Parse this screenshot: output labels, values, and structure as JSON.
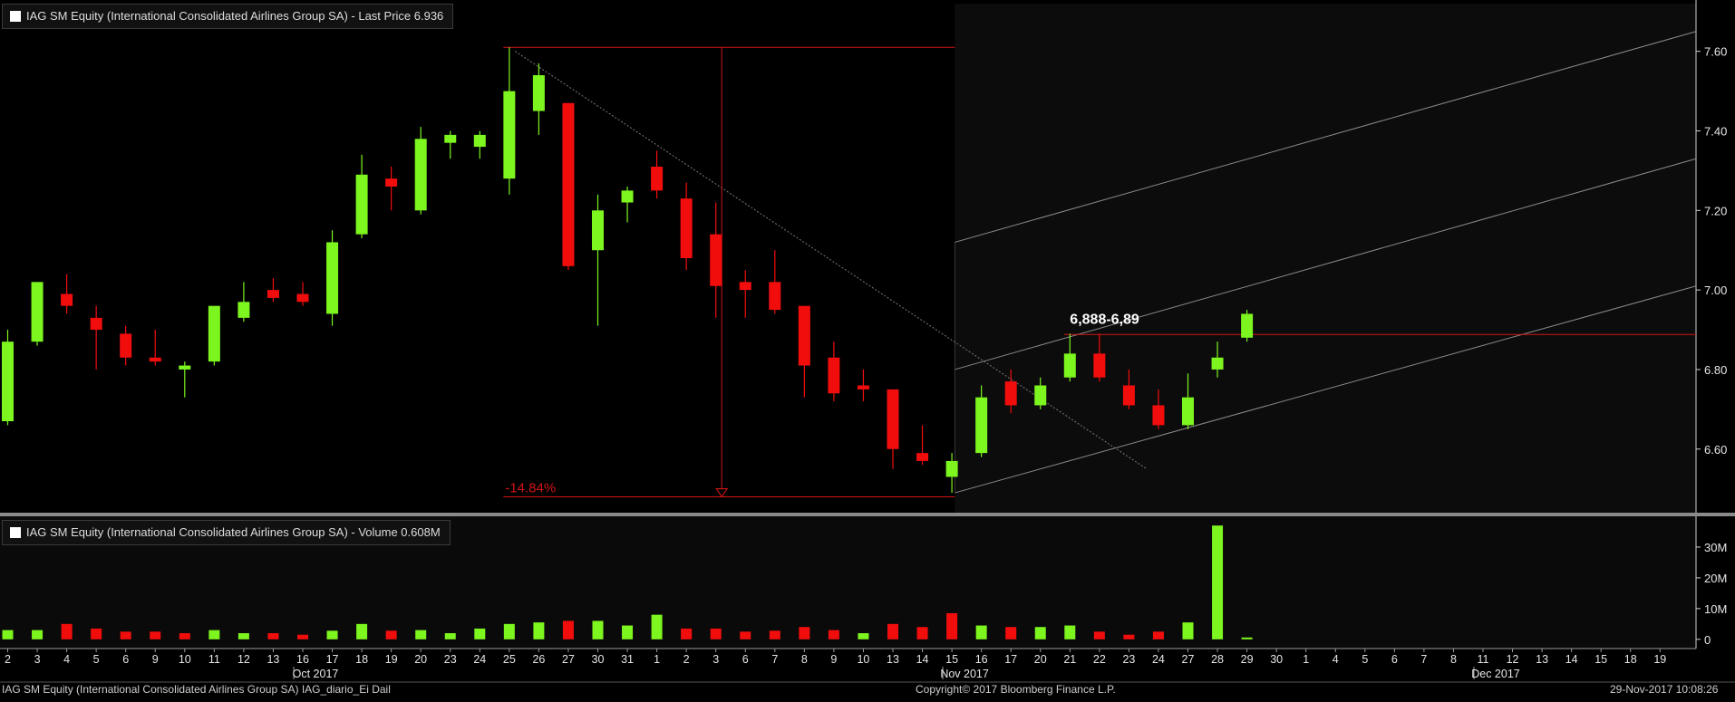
{
  "chart_data": [
    {
      "type": "candlestick",
      "title": "IAG SM Equity (International Consolidated Airlines Group SA) - Last Price 6.936",
      "y_ticks": [
        "7.60",
        "7.40",
        "7.20",
        "7.00",
        "6.80",
        "6.60"
      ],
      "ylim": [
        6.44,
        7.72
      ],
      "x_day_labels": [
        "2",
        "3",
        "4",
        "5",
        "6",
        "9",
        "10",
        "11",
        "12",
        "13",
        "16",
        "17",
        "18",
        "19",
        "20",
        "23",
        "24",
        "25",
        "26",
        "27",
        "30",
        "31",
        "1",
        "2",
        "3",
        "6",
        "7",
        "8",
        "9",
        "10",
        "13",
        "14",
        "15",
        "16",
        "17",
        "20",
        "21",
        "22",
        "23",
        "24",
        "27",
        "28",
        "29",
        "30",
        "1",
        "4",
        "5",
        "6",
        "7",
        "8",
        "11",
        "12",
        "13",
        "14",
        "15",
        "18",
        "19"
      ],
      "x_month_labels": [
        {
          "label": "Oct 2017",
          "index": 10
        },
        {
          "label": "Nov 2017",
          "index": 32
        },
        {
          "label": "Dec 2017",
          "index": 50
        }
      ],
      "candles": [
        {
          "o": 6.67,
          "h": 6.9,
          "l": 6.66,
          "c": 6.87
        },
        {
          "o": 6.87,
          "h": 7.02,
          "l": 6.86,
          "c": 7.02
        },
        {
          "o": 6.99,
          "h": 7.04,
          "l": 6.94,
          "c": 6.96
        },
        {
          "o": 6.93,
          "h": 6.96,
          "l": 6.8,
          "c": 6.9
        },
        {
          "o": 6.89,
          "h": 6.91,
          "l": 6.81,
          "c": 6.83
        },
        {
          "o": 6.83,
          "h": 6.9,
          "l": 6.81,
          "c": 6.82
        },
        {
          "o": 6.8,
          "h": 6.82,
          "l": 6.73,
          "c": 6.81
        },
        {
          "o": 6.82,
          "h": 6.96,
          "l": 6.81,
          "c": 6.96
        },
        {
          "o": 6.93,
          "h": 7.02,
          "l": 6.92,
          "c": 6.97
        },
        {
          "o": 7.0,
          "h": 7.03,
          "l": 6.97,
          "c": 6.98
        },
        {
          "o": 6.99,
          "h": 7.02,
          "l": 6.96,
          "c": 6.97
        },
        {
          "o": 6.94,
          "h": 7.15,
          "l": 6.91,
          "c": 7.12
        },
        {
          "o": 7.14,
          "h": 7.34,
          "l": 7.13,
          "c": 7.29
        },
        {
          "o": 7.28,
          "h": 7.31,
          "l": 7.2,
          "c": 7.26
        },
        {
          "o": 7.2,
          "h": 7.41,
          "l": 7.19,
          "c": 7.38
        },
        {
          "o": 7.37,
          "h": 7.4,
          "l": 7.33,
          "c": 7.39
        },
        {
          "o": 7.36,
          "h": 7.4,
          "l": 7.33,
          "c": 7.39
        },
        {
          "o": 7.28,
          "h": 7.61,
          "l": 7.24,
          "c": 7.5
        },
        {
          "o": 7.45,
          "h": 7.57,
          "l": 7.39,
          "c": 7.54
        },
        {
          "o": 7.47,
          "h": 7.47,
          "l": 7.05,
          "c": 7.06
        },
        {
          "o": 7.1,
          "h": 7.24,
          "l": 6.91,
          "c": 7.2
        },
        {
          "o": 7.22,
          "h": 7.26,
          "l": 7.17,
          "c": 7.25
        },
        {
          "o": 7.31,
          "h": 7.35,
          "l": 7.23,
          "c": 7.25
        },
        {
          "o": 7.23,
          "h": 7.27,
          "l": 7.05,
          "c": 7.08
        },
        {
          "o": 7.14,
          "h": 7.22,
          "l": 6.93,
          "c": 7.01
        },
        {
          "o": 7.02,
          "h": 7.05,
          "l": 6.93,
          "c": 7.0
        },
        {
          "o": 7.02,
          "h": 7.1,
          "l": 6.94,
          "c": 6.95
        },
        {
          "o": 6.96,
          "h": 6.96,
          "l": 6.73,
          "c": 6.81
        },
        {
          "o": 6.83,
          "h": 6.87,
          "l": 6.72,
          "c": 6.74
        },
        {
          "o": 6.76,
          "h": 6.8,
          "l": 6.72,
          "c": 6.75
        },
        {
          "o": 6.75,
          "h": 6.75,
          "l": 6.55,
          "c": 6.6
        },
        {
          "o": 6.59,
          "h": 6.66,
          "l": 6.56,
          "c": 6.57
        },
        {
          "o": 6.53,
          "h": 6.59,
          "l": 6.49,
          "c": 6.57
        },
        {
          "o": 6.59,
          "h": 6.76,
          "l": 6.58,
          "c": 6.73
        },
        {
          "o": 6.77,
          "h": 6.8,
          "l": 6.69,
          "c": 6.71
        },
        {
          "o": 6.71,
          "h": 6.78,
          "l": 6.7,
          "c": 6.76
        },
        {
          "o": 6.78,
          "h": 6.89,
          "l": 6.77,
          "c": 6.84
        },
        {
          "o": 6.84,
          "h": 6.89,
          "l": 6.77,
          "c": 6.78
        },
        {
          "o": 6.76,
          "h": 6.8,
          "l": 6.7,
          "c": 6.71
        },
        {
          "o": 6.71,
          "h": 6.75,
          "l": 6.65,
          "c": 6.66
        },
        {
          "o": 6.66,
          "h": 6.79,
          "l": 6.65,
          "c": 6.73
        },
        {
          "o": 6.8,
          "h": 6.87,
          "l": 6.78,
          "c": 6.83
        },
        {
          "o": 6.88,
          "h": 6.95,
          "l": 6.87,
          "c": 6.94
        }
      ],
      "annotations": {
        "level_label": "6,888-6,89",
        "level": 6.888,
        "drop_label": "-14.84%",
        "drop_top": 7.61,
        "drop_bottom": 6.48
      },
      "colors": {
        "up": "#7df51f",
        "down": "#f20d0d",
        "annotation": "#d41515",
        "channel": "#8a8a8a"
      }
    },
    {
      "type": "bar",
      "title": "IAG SM Equity (International Consolidated Airlines Group SA) - Volume 0.608M",
      "y_ticks": [
        "30M",
        "20M",
        "10M",
        "0"
      ],
      "ylim": [
        -3,
        40
      ],
      "volumes": [
        3,
        3,
        5,
        3.5,
        2.5,
        2.5,
        2,
        3,
        2,
        2,
        1.5,
        2.8,
        5,
        2.8,
        3,
        2,
        3.5,
        5,
        5.5,
        6,
        6,
        4.5,
        8,
        3.5,
        3.5,
        2.5,
        2.8,
        4,
        3,
        2,
        5,
        4,
        8.5,
        4.5,
        4,
        4,
        4.5,
        2.5,
        1.5,
        2.5,
        5.5,
        37,
        0.6
      ],
      "up": [
        1,
        1,
        0,
        0,
        0,
        0,
        0,
        1,
        1,
        0,
        0,
        1,
        1,
        0,
        1,
        1,
        1,
        1,
        1,
        0,
        1,
        1,
        1,
        0,
        0,
        0,
        0,
        0,
        0,
        1,
        0,
        0,
        0,
        1,
        0,
        1,
        1,
        0,
        0,
        0,
        1,
        1,
        1
      ]
    }
  ],
  "footer": {
    "left": "IAG SM Equity (International Consolidated Airlines Group SA) IAG_diario_Ei  Dail",
    "center": "Copyright© 2017 Bloomberg Finance L.P.",
    "right": "29-Nov-2017 10:08:26"
  }
}
